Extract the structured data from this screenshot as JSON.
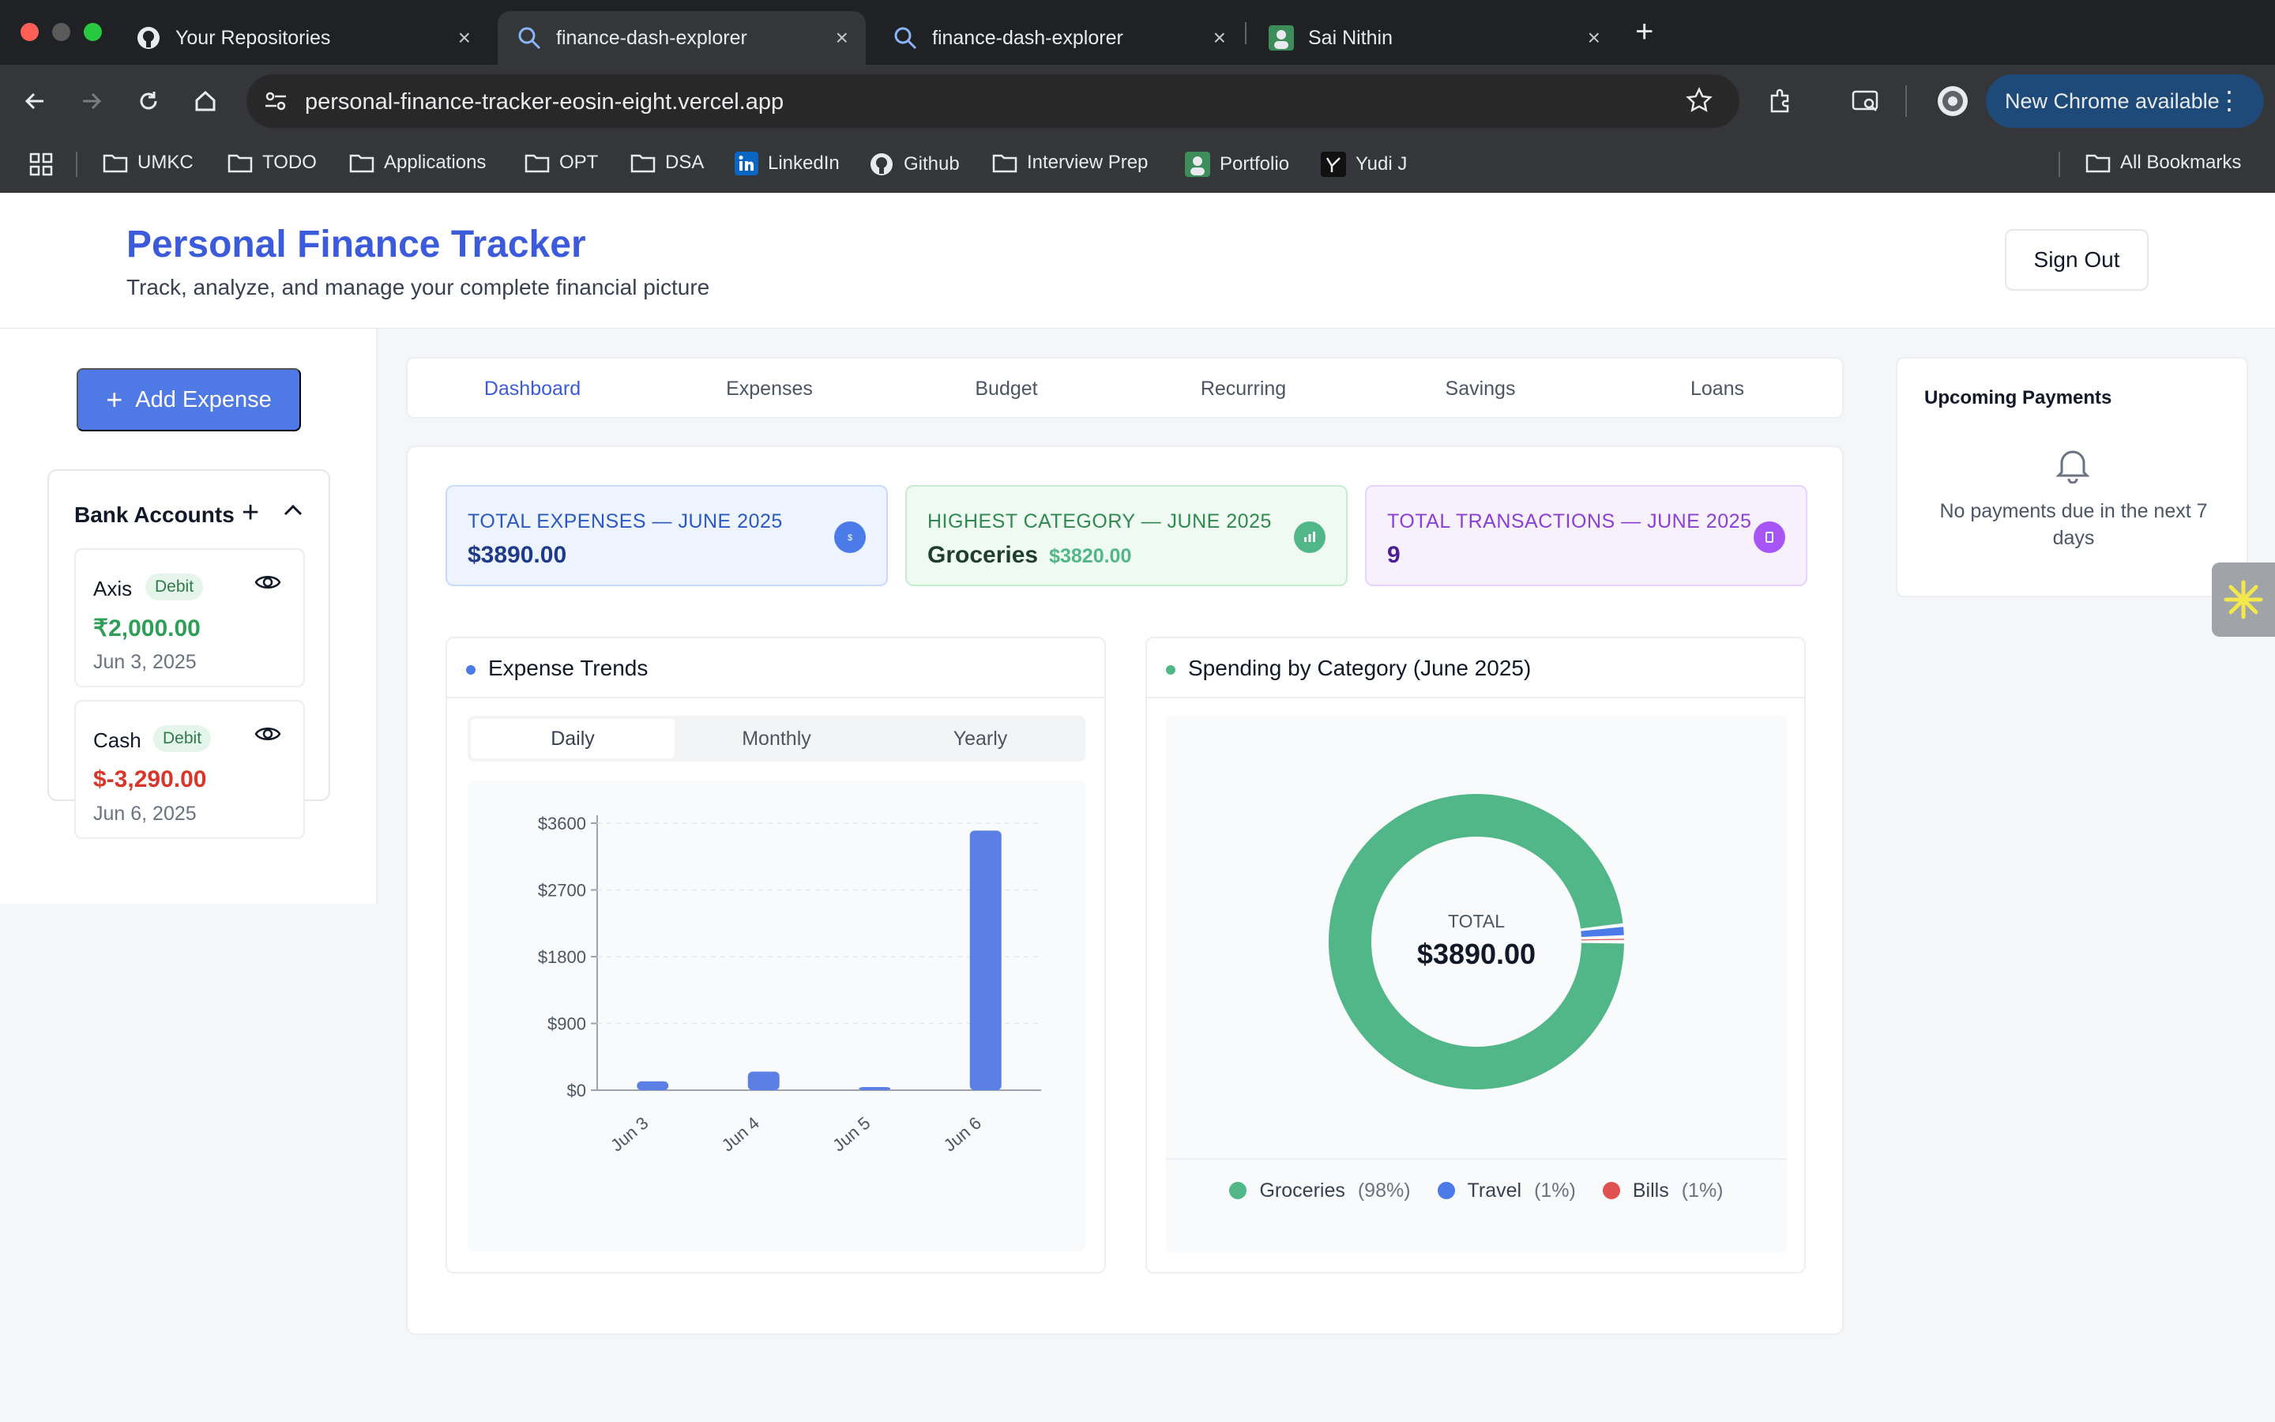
{
  "browser": {
    "tabs": [
      {
        "title": "Your Repositories",
        "icon": "github-icon"
      },
      {
        "title": "finance-dash-explorer",
        "icon": "explorer-icon"
      },
      {
        "title": "finance-dash-explorer",
        "icon": "explorer-icon"
      },
      {
        "title": "Sai Nithin",
        "icon": "avatar-icon"
      }
    ],
    "url": "personal-finance-tracker-eosin-eight.vercel.app",
    "update_label": "New Chrome available",
    "bookmarks": [
      "UMKC",
      "TODO",
      "Applications",
      "OPT",
      "DSA",
      "LinkedIn",
      "Github",
      "Interview Prep",
      "Portfolio",
      "Yudi J"
    ],
    "all_bookmarks": "All Bookmarks"
  },
  "header": {
    "title": "Personal Finance Tracker",
    "subtitle": "Track, analyze, and manage your complete financial picture",
    "sign_out": "Sign Out"
  },
  "sidebar": {
    "add_expense": "Add Expense",
    "bank_accounts_title": "Bank Accounts",
    "accounts": [
      {
        "name": "Axis",
        "type": "Debit",
        "amount": "₹2,000.00",
        "date": "Jun 3, 2025",
        "amount_color": "#2f9e57"
      },
      {
        "name": "Cash",
        "type": "Debit",
        "amount": "$-3,290.00",
        "date": "Jun 6, 2025",
        "amount_color": "#d9362b"
      }
    ]
  },
  "nav_tabs": [
    "Dashboard",
    "Expenses",
    "Budget",
    "Recurring",
    "Savings",
    "Loans"
  ],
  "active_tab": "Dashboard",
  "stats": [
    {
      "label": "TOTAL EXPENSES — JUNE 2025",
      "value": "$3890.00",
      "sub": ""
    },
    {
      "label": "HIGHEST CATEGORY — JUNE 2025",
      "value": "Groceries",
      "sub": "$3820.00"
    },
    {
      "label": "TOTAL TRANSACTIONS — JUNE 2025",
      "value": "9",
      "sub": ""
    }
  ],
  "trends": {
    "title": "Expense Trends",
    "periods": [
      "Daily",
      "Monthly",
      "Yearly"
    ],
    "active_period": "Daily"
  },
  "category": {
    "title": "Spending by Category (June 2025)",
    "center_label": "TOTAL",
    "center_value": "$3890.00"
  },
  "upcoming": {
    "title": "Upcoming Payments",
    "empty_text": "No payments due in the next 7 days"
  },
  "colors": {
    "primary": "#4f7ae6",
    "groceries": "#52b788",
    "travel": "#4a7be8",
    "bills": "#e05252"
  },
  "chart_data": [
    {
      "type": "bar",
      "title": "Expense Trends",
      "categories": [
        "Jun 3",
        "Jun 4",
        "Jun 5",
        "Jun 6"
      ],
      "values": [
        120,
        250,
        20,
        3500
      ],
      "yticks": [
        "$0",
        "$900",
        "$1800",
        "$2700",
        "$3600"
      ],
      "ylim": [
        0,
        3600
      ],
      "xlabel": "",
      "ylabel": ""
    },
    {
      "type": "pie",
      "title": "Spending by Category (June 2025)",
      "categories": [
        "Groceries",
        "Travel",
        "Bills"
      ],
      "values": [
        3820,
        50,
        20
      ],
      "percent_labels": [
        "(98%)",
        "(1%)",
        "(1%)"
      ],
      "legend_position": "bottom"
    }
  ]
}
